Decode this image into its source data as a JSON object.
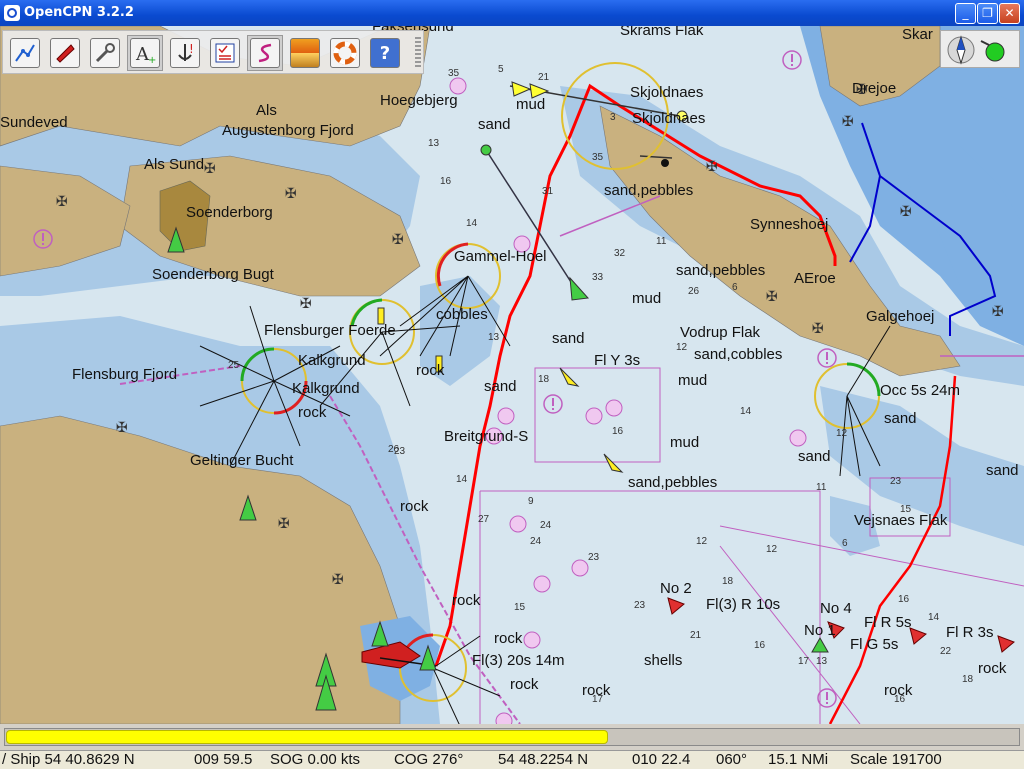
{
  "window": {
    "title": "OpenCPN 3.2.2"
  },
  "toolbar": {
    "buttons": [
      {
        "name": "route-icon"
      },
      {
        "name": "boat-icon"
      },
      {
        "name": "wrench-icon"
      },
      {
        "name": "text-icon"
      },
      {
        "name": "anchor-alert-icon"
      },
      {
        "name": "checklist-icon"
      },
      {
        "name": "track-icon"
      },
      {
        "name": "tide-icon"
      },
      {
        "name": "lifebuoy-icon"
      },
      {
        "name": "help-icon"
      }
    ]
  },
  "map": {
    "places": {
      "sundeved": "Sundeved",
      "als": "Als",
      "augustenborg": "Augustenborg Fjord",
      "hoegebjerg": "Hoegebjerg",
      "als_sund": "Als Sund",
      "soenderborg": "Soenderborg",
      "soenderborg_bugt": "Soenderborg Bugt",
      "flensburger_foerde": "Flensburger Foerde",
      "kalkgrund1": "Kalkgrund",
      "kalkgrund2": "Kalkgrund",
      "flensburg_fjord": "Flensburg Fjord",
      "geltinger_bucht": "Geltinger Bucht",
      "breitgrund": "Breitgrund-S",
      "gammel_hoel": "Gammel-Hoel",
      "skjoldnaes1": "Skjoldnaes",
      "skjoldnaes2": "Skjoldnaes",
      "skramsflak": "Skrams Flak",
      "skarp": "Skar",
      "drejoe": "Drejoe",
      "synneshoej": "Synneshoej",
      "aeroe": "AEroe",
      "galgehoej": "Galgehoej",
      "vodrup_flak": "Vodrup Flak",
      "vejsnaes_flak": "Vejsnaes Flak",
      "fakse": "Faksensund"
    },
    "bottoms": {
      "mud1": "mud",
      "sand1": "sand",
      "cobbles": "cobbles",
      "rock1": "rock",
      "rock2": "rock",
      "sand2": "sand",
      "sand_pebbles1": "sand,pebbles",
      "sand_pebbles2": "sand,pebbles",
      "mud2": "mud",
      "sand3": "sand",
      "sand_cobbles": "sand,cobbles",
      "mud3": "mud",
      "mud4": "mud",
      "sand_pebbles3": "sand,pebbles",
      "sand4": "sand",
      "sand5": "sand",
      "sand6": "sand",
      "rock3": "rock",
      "rock4": "rock",
      "rock5": "rock",
      "rock6": "rock",
      "shells": "shells",
      "rock7": "rock",
      "rock8": "rock",
      "rock9": "rock",
      "rock10": "rock"
    },
    "lights": {
      "fl_y_3s": "Fl Y 3s",
      "occ": "Occ 5s 24m",
      "fl3_20s": "Fl(3) 20s 14m",
      "fl3_r10s": "Fl(3) R 10s",
      "fl_r5s": "Fl R 5s",
      "fl_g5s": "Fl G 5s",
      "fl_r3s": "Fl R 3s",
      "no2": "No 2",
      "no4": "No 4",
      "no1": "No 1"
    },
    "depths": [
      "35",
      "21",
      "5",
      "31",
      "35",
      "16",
      "13",
      "14",
      "3",
      "33",
      "32",
      "11",
      "26",
      "6",
      "14",
      "12",
      "13",
      "23",
      "14",
      "27",
      "24",
      "24",
      "23",
      "15",
      "12",
      "12",
      "11",
      "6",
      "23",
      "15",
      "12",
      "18",
      "16",
      "21",
      "23",
      "18",
      "17",
      "13",
      "16",
      "22",
      "18",
      "16",
      "17",
      "9",
      "26",
      "25",
      "16",
      "14"
    ]
  },
  "progress": {
    "value": 0.595
  },
  "status": {
    "ship": "/ Ship 54 40.8629 N",
    "ship_lon": "009 59.5",
    "sog": "SOG 0.00 kts",
    "cog": "COG 276°",
    "cursor_lat": "54 48.2254 N",
    "cursor_lon": "010 22.4",
    "bearing": "060°",
    "range": "15.1 NMi",
    "scale": "Scale 191700"
  },
  "colors": {
    "land": "#c9b17f",
    "shallow": "#a9c9e6",
    "deep": "#7fb0e3",
    "water": "#d7e6ef",
    "route": "#ff0000",
    "progress": "#ffff00"
  }
}
